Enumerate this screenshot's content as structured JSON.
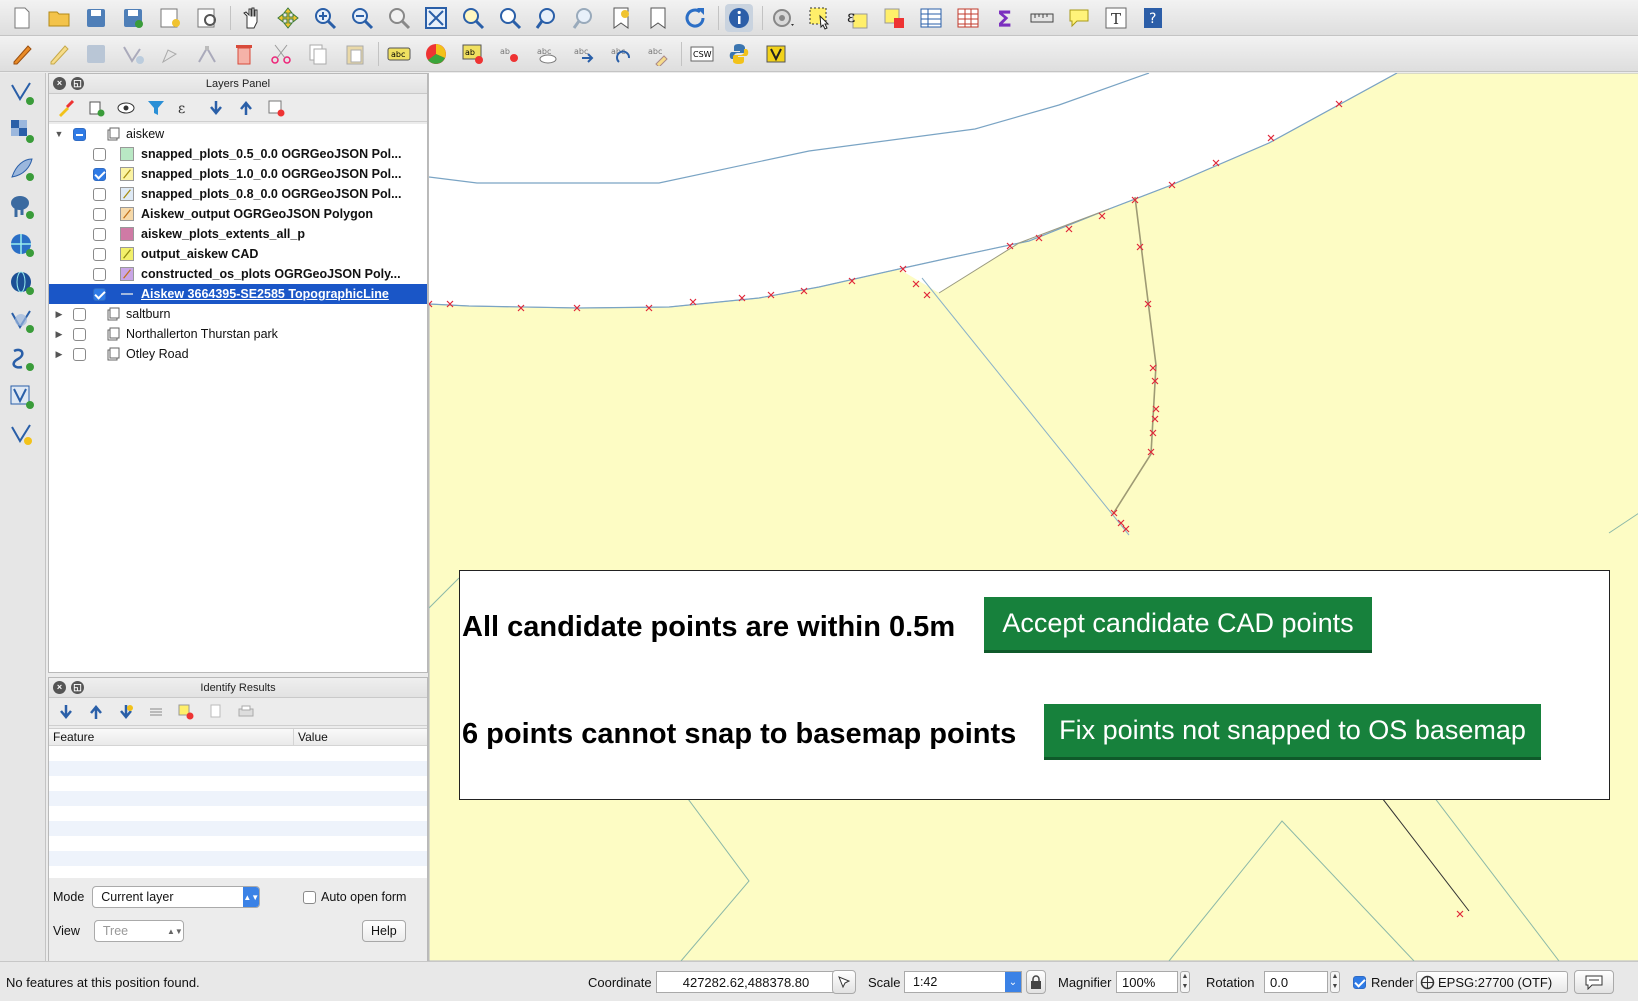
{
  "layers_panel": {
    "title": "Layers Panel",
    "groups": [
      {
        "name": "aiskew",
        "expanded": true,
        "state": "partial",
        "layers": [
          {
            "name": "snapped_plots_0.5_0.0 OGRGeoJSON Pol...",
            "checked": false,
            "icon": "polygon-green",
            "color": "#b9e8c4"
          },
          {
            "name": "snapped_plots_1.0_0.0 OGRGeoJSON Pol...",
            "checked": true,
            "icon": "line-yellow",
            "color": "#fbf3a2"
          },
          {
            "name": "snapped_plots_0.8_0.0 OGRGeoJSON Pol...",
            "checked": false,
            "icon": "line-blue",
            "color": "#dfeaf5"
          },
          {
            "name": "Aiskew_output OGRGeoJSON Polygon",
            "checked": false,
            "icon": "line-orange",
            "color": "#f6d9a9"
          },
          {
            "name": "aiskew_plots_extents_all_p",
            "checked": false,
            "icon": "polygon-pink",
            "color": "#cf7aa5"
          },
          {
            "name": "output_aiskew CAD",
            "checked": false,
            "icon": "line-yellow",
            "color": "#f2f06a"
          },
          {
            "name": "constructed_os_plots OGRGeoJSON Poly...",
            "checked": false,
            "icon": "line-purple",
            "color": "#c9a6e6"
          },
          {
            "name": "Aiskew 3664395-SE2585 TopographicLine",
            "checked": true,
            "icon": "line-grey",
            "color": "#bbbbbb",
            "selected": true
          }
        ]
      },
      {
        "name": "saltburn",
        "expanded": false,
        "state": "off"
      },
      {
        "name": "Northallerton Thurstan park",
        "expanded": false,
        "state": "off"
      },
      {
        "name": "Otley Road",
        "expanded": false,
        "state": "off"
      }
    ]
  },
  "identify": {
    "title": "Identify Results",
    "col_feature": "Feature",
    "col_value": "Value",
    "mode_label": "Mode",
    "mode_value": "Current layer",
    "auto_open_label": "Auto open form",
    "view_label": "View",
    "view_value": "Tree",
    "help_label": "Help"
  },
  "overlay": {
    "msg1": "All candidate points are within 0.5m",
    "btn1": "Accept candidate CAD points",
    "msg2": "6 points cannot snap to basemap points",
    "btn2": "Fix points not snapped to OS basemap"
  },
  "statusbar": {
    "message": "No features at this position found.",
    "coord_label": "Coordinate",
    "coord_value": "427282.62,488378.80",
    "scale_label": "Scale",
    "scale_value": "1:42",
    "magnifier_label": "Magnifier",
    "magnifier_value": "100%",
    "rotation_label": "Rotation",
    "rotation_value": "0.0",
    "render_label": "Render",
    "render_checked": true,
    "crs_value": "EPSG:27700 (OTF)"
  },
  "colors": {
    "selection": "#1a56c7",
    "map_fill": "#fdfcc4",
    "accent_green": "#17813c",
    "point_marker": "#e0283a"
  }
}
